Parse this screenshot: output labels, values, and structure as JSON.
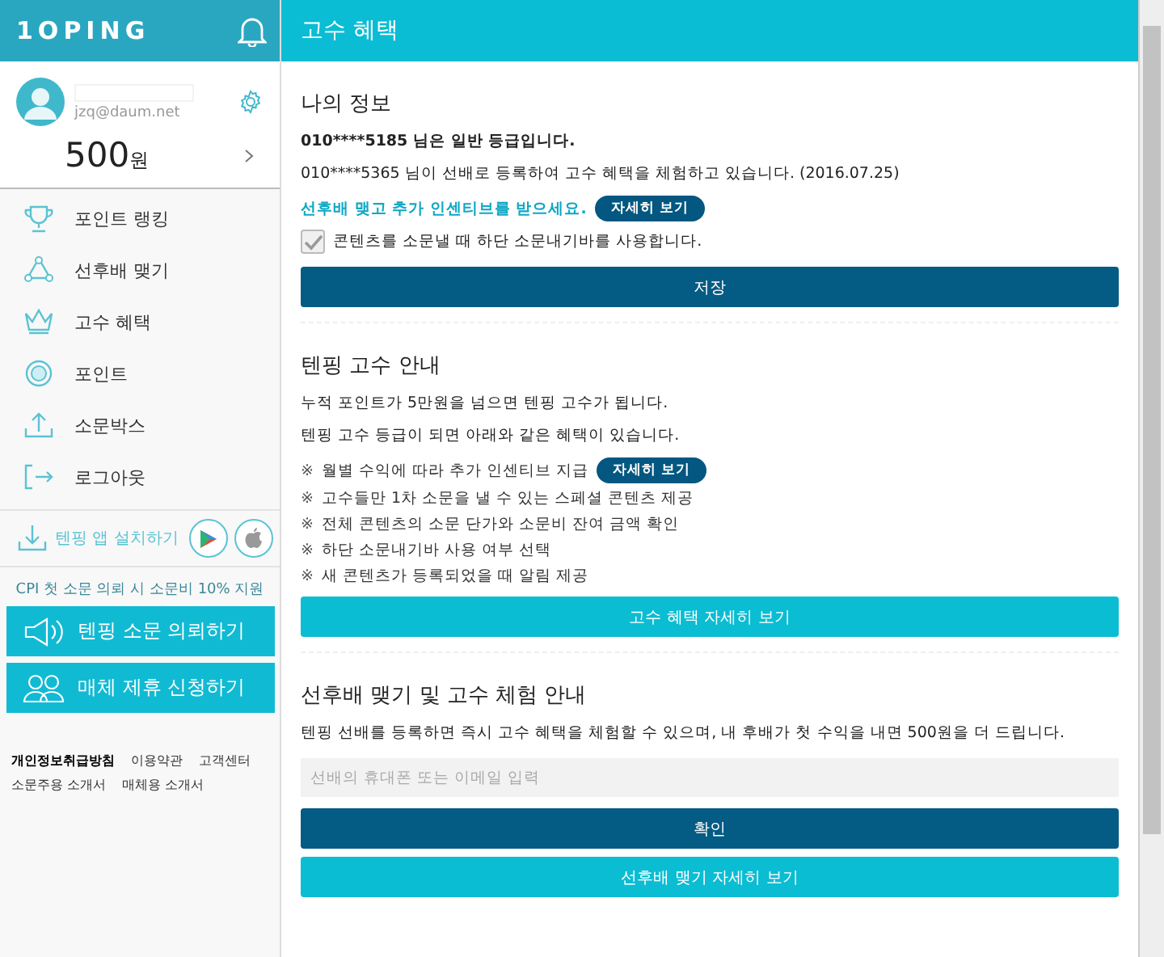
{
  "sidebar": {
    "logo": "1OPING",
    "profile": {
      "email": "jzq@daum.net",
      "balance": "500",
      "currency": "원"
    },
    "menu": [
      {
        "label": "포인트 랭킹"
      },
      {
        "label": "선후배 맺기"
      },
      {
        "label": "고수 혜택"
      },
      {
        "label": "포인트"
      },
      {
        "label": "소문박스"
      },
      {
        "label": "로그아웃"
      }
    ],
    "app_install": {
      "label": "텐핑 앱 설치하기"
    },
    "cpi_notice": "CPI 첫 소문 의뢰 시 소문비 10% 지원",
    "action_buttons": [
      {
        "label": "텐핑 소문 의뢰하기"
      },
      {
        "label": "매체 제휴 신청하기"
      }
    ],
    "footer_links": [
      {
        "label": "개인정보취급방침",
        "emphasized": true
      },
      {
        "label": "이용약관",
        "emphasized": false
      },
      {
        "label": "고객센터",
        "emphasized": false
      },
      {
        "label": "소문주용 소개서",
        "emphasized": false
      },
      {
        "label": "매체용 소개서",
        "emphasized": false
      }
    ]
  },
  "main": {
    "title": "고수 혜택",
    "my_info": {
      "heading": "나의 정보",
      "grade_text": "010****5185 님은 일반 등급입니다.",
      "trial_text": "010****5365 님이 선배로 등록하여 고수 혜택을 체험하고 있습니다. (2016.07.25)",
      "incentive_text": "선후배 맺고 추가 인센티브를 받으세요.",
      "incentive_button": "자세히 보기",
      "checkbox": {
        "label": "콘텐츠를 소문낼 때 하단 소문내기바를 사용합니다.",
        "checked": true
      },
      "save_button": "저장"
    },
    "guide": {
      "heading": "텐핑 고수 안내",
      "lines": [
        "누적 포인트가 5만원을 넘으면 텐핑 고수가 됩니다.",
        "텐핑 고수 등급이 되면 아래와 같은 혜택이 있습니다."
      ],
      "benefits": [
        {
          "mark": "※",
          "text": "월별 수익에 따라 추가 인센티브 지급",
          "button": "자세히 보기"
        },
        {
          "mark": "※",
          "text": "고수들만 1차 소문을 낼 수 있는 스페셜 콘텐츠 제공"
        },
        {
          "mark": "※",
          "text": "전체 콘텐츠의 소문 단가와 소문비 잔여 금액 확인"
        },
        {
          "mark": "※",
          "text": "하단 소문내기바 사용 여부 선택"
        },
        {
          "mark": "※",
          "text": "새 콘텐츠가 등록되었을 때 알림 제공"
        }
      ],
      "button": "고수 혜택 자세히 보기"
    },
    "mentor": {
      "heading": "선후배 맺기 및 고수 체험 안내",
      "text": "텐핑 선배를 등록하면 즉시 고수 혜택을 체험할 수 있으며, 내 후배가 첫 수익을 내면 500원을 더 드립니다.",
      "placeholder": "선배의 휴대폰 또는 이메일 입력",
      "confirm_button": "확인",
      "more_button": "선후배 맺기 자세히 보기"
    }
  }
}
